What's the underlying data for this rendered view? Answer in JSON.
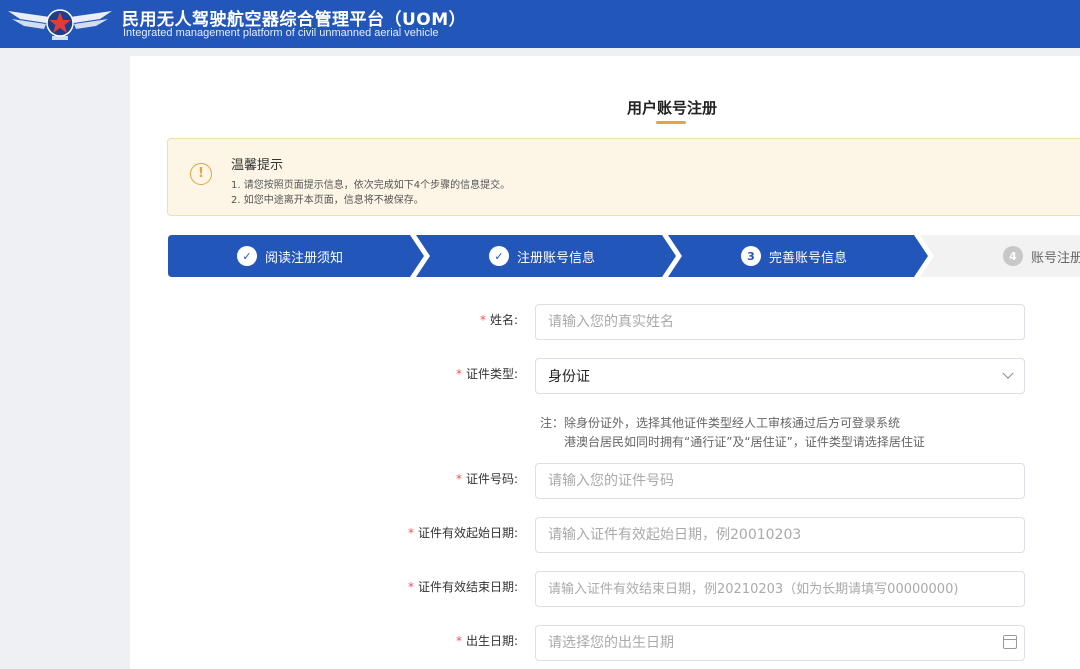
{
  "header": {
    "title": "民用无人驾驶航空器综合管理平台（UOM）",
    "subtitle": "Integrated management platform of civil unmanned aerial vehicle",
    "logo_icon": "wings-star-logo",
    "bg_color": "#2256b8"
  },
  "page": {
    "title": "用户账号注册",
    "accent_color": "#e6a23c"
  },
  "notice": {
    "icon": "exclamation-icon",
    "title": "温馨提示",
    "lines": [
      "1. 请您按照页面提示信息，依次完成如下4个步骤的信息提交。",
      "2. 如您中途离开本页面，信息将不被保存。"
    ]
  },
  "steps": [
    {
      "marker": "✓",
      "label": "阅读注册须知",
      "state": "done"
    },
    {
      "marker": "✓",
      "label": "注册账号信息",
      "state": "done"
    },
    {
      "marker": "3",
      "label": "完善账号信息",
      "state": "current"
    },
    {
      "marker": "4",
      "label": "账号注册完",
      "state": "pending"
    }
  ],
  "form": {
    "required_mark": "*",
    "name": {
      "label": "姓名:",
      "placeholder": "请输入您的真实姓名"
    },
    "id_type": {
      "label": "证件类型:",
      "value": "身份证"
    },
    "id_type_note": [
      "注：除身份证外，选择其他证件类型经人工审核通过后方可登录系统",
      "港澳台居民如同时拥有“通行证”及“居住证”，证件类型请选择居住证"
    ],
    "id_number": {
      "label": "证件号码:",
      "placeholder": "请输入您的证件号码"
    },
    "valid_start": {
      "label": "证件有效起始日期:",
      "placeholder": "请输入证件有效起始日期，例20010203"
    },
    "valid_end": {
      "label": "证件有效结束日期:",
      "placeholder": "请输入证件有效结束日期，例20210203（如为长期请填写00000000)"
    },
    "birth_date": {
      "label": "出生日期:",
      "placeholder": "请选择您的出生日期"
    }
  }
}
